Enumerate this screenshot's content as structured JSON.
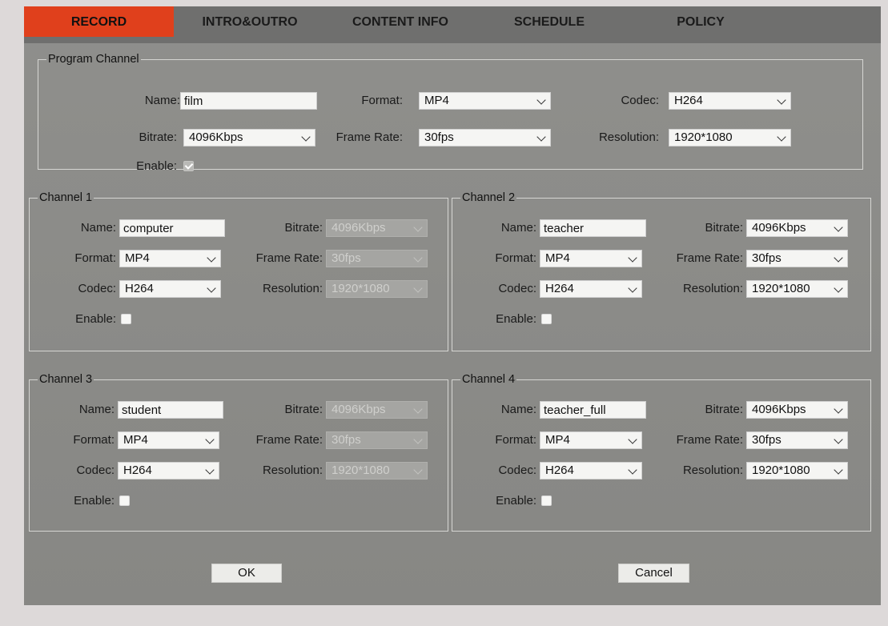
{
  "tabs": [
    {
      "label": "RECORD",
      "active": true
    },
    {
      "label": "INTRO&OUTRO",
      "active": false
    },
    {
      "label": "CONTENT INFO",
      "active": false
    },
    {
      "label": "SCHEDULE",
      "active": false
    },
    {
      "label": "POLICY",
      "active": false
    }
  ],
  "colors": {
    "active_tab": "#e0401c",
    "panel": "#8a8a87",
    "tab_bar": "#6f6f6e"
  },
  "labels": {
    "name": "Name:",
    "format": "Format:",
    "codec": "Codec:",
    "bitrate": "Bitrate:",
    "frame_rate": "Frame Rate:",
    "resolution": "Resolution:",
    "enable": "Enable:"
  },
  "program": {
    "legend": "Program Channel",
    "name": "film",
    "format": "MP4",
    "codec": "H264",
    "bitrate": "4096Kbps",
    "frame_rate": "30fps",
    "resolution": "1920*1080",
    "enabled": true
  },
  "channels": [
    {
      "legend": "Channel 1",
      "name": "computer",
      "bitrate": "4096Kbps",
      "format": "MP4",
      "frame_rate": "30fps",
      "codec": "H264",
      "resolution": "1920*1080",
      "enabled": false,
      "detail_disabled": true
    },
    {
      "legend": "Channel 2",
      "name": "teacher",
      "bitrate": "4096Kbps",
      "format": "MP4",
      "frame_rate": "30fps",
      "codec": "H264",
      "resolution": "1920*1080",
      "enabled": false,
      "detail_disabled": false
    },
    {
      "legend": "Channel 3",
      "name": "student",
      "bitrate": "4096Kbps",
      "format": "MP4",
      "frame_rate": "30fps",
      "codec": "H264",
      "resolution": "1920*1080",
      "enabled": false,
      "detail_disabled": true
    },
    {
      "legend": "Channel 4",
      "name": "teacher_full",
      "bitrate": "4096Kbps",
      "format": "MP4",
      "frame_rate": "30fps",
      "codec": "H264",
      "resolution": "1920*1080",
      "enabled": false,
      "detail_disabled": false
    }
  ],
  "buttons": {
    "ok": "OK",
    "cancel": "Cancel"
  }
}
